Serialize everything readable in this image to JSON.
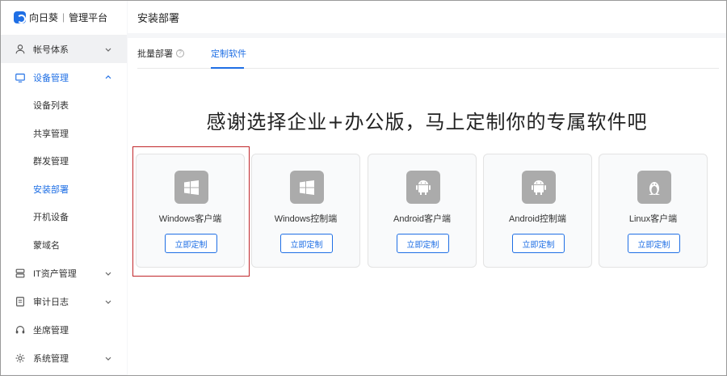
{
  "brand": {
    "name": "向日葵",
    "separator": "|",
    "platform": "管理平台"
  },
  "sidebar": {
    "items": [
      {
        "label": "帐号体系",
        "icon": "user-icon",
        "expandable": true
      },
      {
        "label": "设备管理",
        "icon": "monitor-icon",
        "expandable": true,
        "expanded": true,
        "children": [
          "设备列表",
          "共享管理",
          "群发管理",
          "安装部署",
          "开机设备",
          "蒙域名"
        ],
        "current_child": "安装部署"
      },
      {
        "label": "IT资产管理",
        "icon": "server-icon",
        "expandable": true
      },
      {
        "label": "审计日志",
        "icon": "document-icon",
        "expandable": true
      },
      {
        "label": "坐席管理",
        "icon": "headset-icon",
        "expandable": false
      },
      {
        "label": "系统管理",
        "icon": "gear-icon",
        "expandable": true
      }
    ]
  },
  "topbar": {
    "title": "安装部署"
  },
  "tabs": [
    {
      "label": "批量部署",
      "has_help": true,
      "help_glyph": "?"
    },
    {
      "label": "定制软件",
      "active": true
    }
  ],
  "headline": "感谢选择企业+办公版，马上定制你的专属软件吧",
  "cards": [
    {
      "title": "Windows客户端",
      "icon": "windows-icon",
      "button": "立即定制",
      "highlighted": true
    },
    {
      "title": "Windows控制端",
      "icon": "windows-icon",
      "button": "立即定制"
    },
    {
      "title": "Android客户端",
      "icon": "android-icon",
      "button": "立即定制"
    },
    {
      "title": "Android控制端",
      "icon": "android-icon",
      "button": "立即定制"
    },
    {
      "title": "Linux客户端",
      "icon": "linux-icon",
      "button": "立即定制"
    }
  ],
  "colors": {
    "accent": "#1f6fe5",
    "highlight": "#c0262a",
    "icon_bg": "#ababab"
  }
}
